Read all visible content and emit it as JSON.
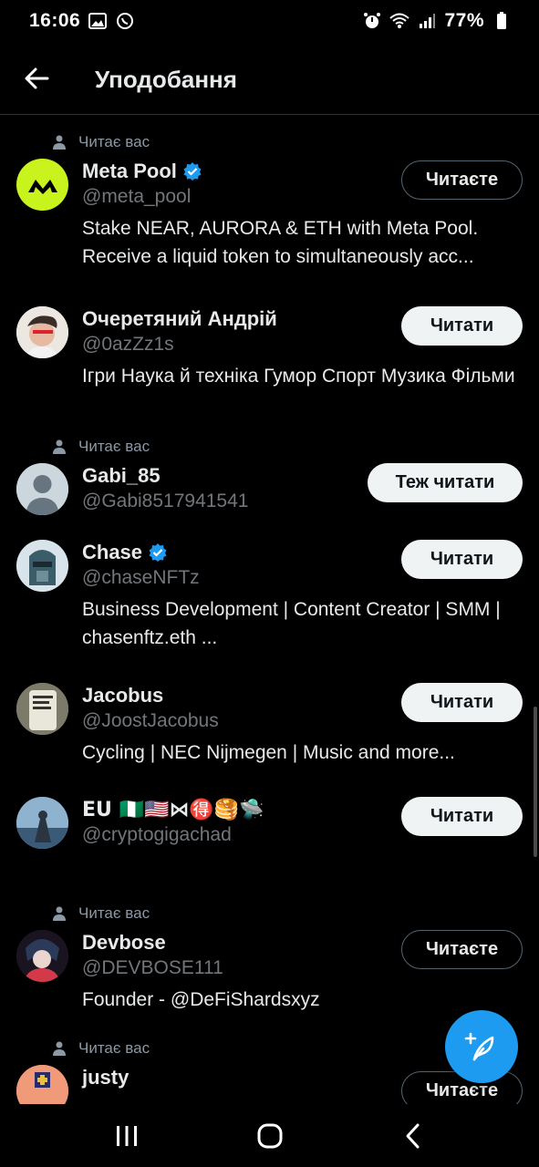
{
  "status_bar": {
    "time": "16:06",
    "battery": "77%"
  },
  "header": {
    "title": "Уподобання"
  },
  "follows_you_label": "Читає вас",
  "colors": {
    "accent": "#1d9bf0",
    "verified": "#1d9bf0",
    "meta_pool": "#c8f31d"
  },
  "users": [
    {
      "name": "Meta Pool",
      "handle": "@meta_pool",
      "verified": true,
      "follows_you": true,
      "button": "Читаєте",
      "bio": "Stake NEAR, AURORA & ETH with Meta Pool. Receive a liquid token to simultaneously acc..."
    },
    {
      "name": "Очеретяний Андрій",
      "handle": "@0azZz1s",
      "verified": false,
      "follows_you": false,
      "button": "Читати",
      "bio": "Ігри Наука й техніка Гумор Спорт Музика Фільми"
    },
    {
      "name": "Gabi_85",
      "handle": "@Gabi8517941541",
      "verified": false,
      "follows_you": true,
      "button": "Теж читати",
      "bio": ""
    },
    {
      "name": "Chase",
      "handle": "@chaseNFTz",
      "verified": true,
      "follows_you": false,
      "button": "Читати",
      "bio": "Business Development | Content Creator | SMM | chasenftz.eth ..."
    },
    {
      "name": "Jacobus",
      "handle": "@JoostJacobus",
      "verified": false,
      "follows_you": false,
      "button": "Читати",
      "bio": "Cycling | NEC Nijmegen | Music and more..."
    },
    {
      "name": "EU 🇳🇬🇺🇸⋈🉐🥞🛸",
      "handle": "@cryptogigachad",
      "verified": false,
      "follows_you": false,
      "button": "Читати",
      "bio": ""
    },
    {
      "name": "Devbose",
      "handle": "@DEVBOSE111",
      "verified": false,
      "follows_you": true,
      "button": "Читаєте",
      "bio": "Founder - @DeFiShardsxyz"
    },
    {
      "name": "justy",
      "handle": "",
      "verified": false,
      "follows_you": true,
      "button": "Читаєте",
      "bio": ""
    }
  ]
}
